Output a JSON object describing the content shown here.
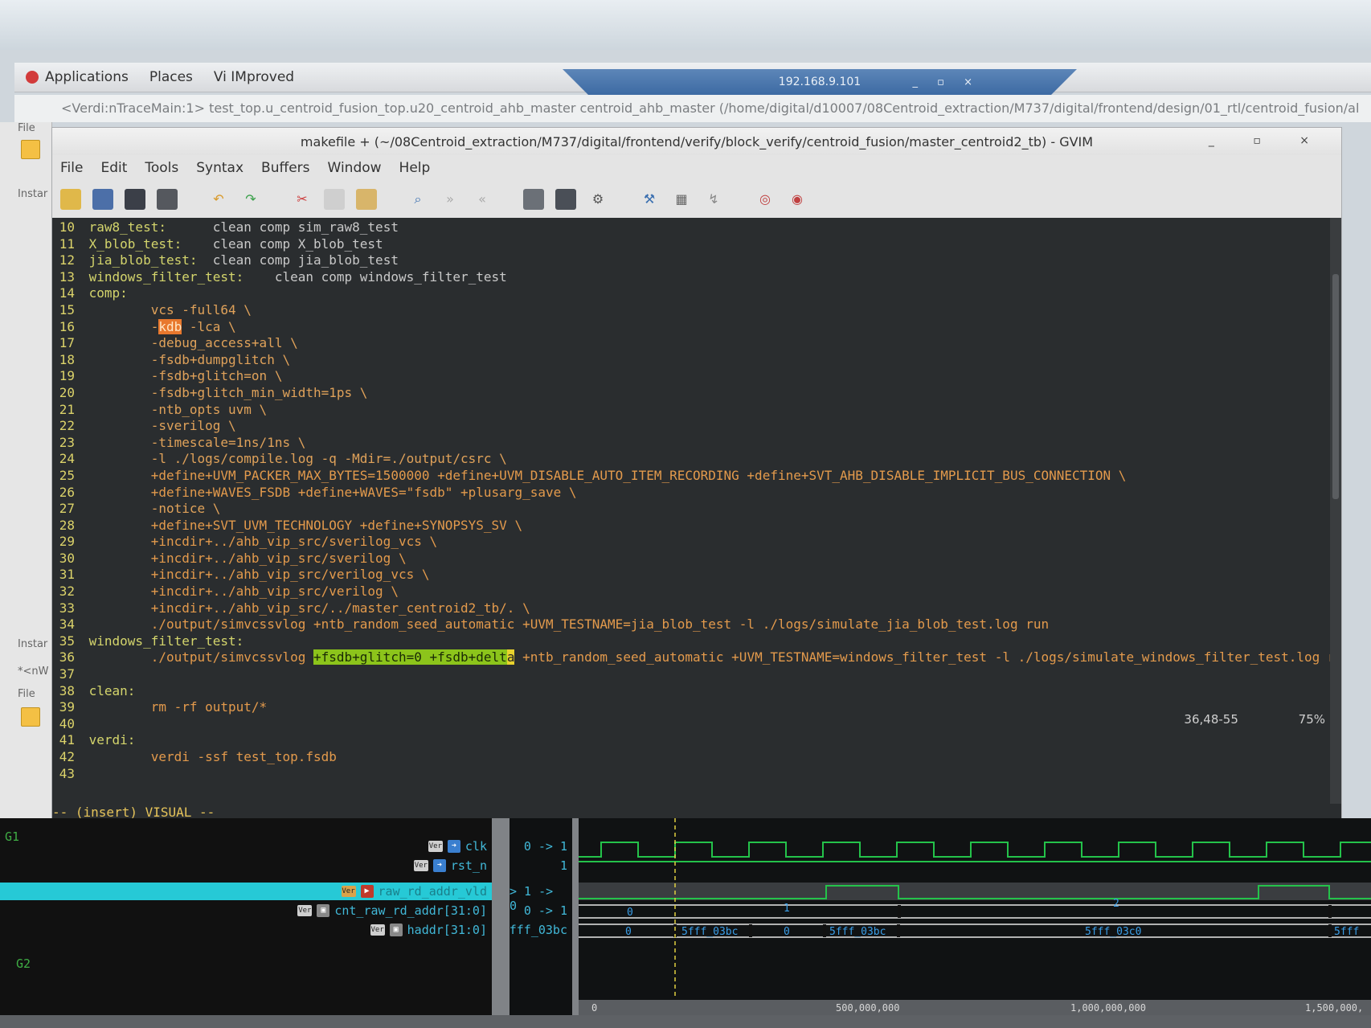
{
  "desktop": {
    "menus": [
      "Applications",
      "Places",
      "Vi IMproved"
    ],
    "remote_title": "192.168.9.101",
    "remote_controls": "_ ▫ ×"
  },
  "verdi": {
    "title": "<Verdi:nTraceMain:1> test_top.u_centroid_fusion_top.u20_centroid_ahb_master centroid_ahb_master (/home/digital/d10007/08Centroid_extraction/M737/digital/frontend/design/01_rtl/centroid_fusion/al",
    "left_labels": [
      "File",
      "Instar",
      "Instar",
      "*<nW",
      "File"
    ]
  },
  "gvim": {
    "title": "makefile + (~/08Centroid_extraction/M737/digital/frontend/verify/block_verify/centroid_fusion/master_centroid2_tb) - GVIM",
    "window_controls": "_ ▫ ×",
    "menu": [
      "File",
      "Edit",
      "Tools",
      "Syntax",
      "Buffers",
      "Window",
      "Help"
    ],
    "toolbar_icons": [
      "open-icon",
      "save-icon",
      "save-all-icon",
      "print-icon",
      "undo-icon",
      "redo-icon",
      "cut-icon",
      "copy-icon",
      "paste-icon",
      "find-replace-icon",
      "find-next-icon",
      "find-prev-icon",
      "load-session-icon",
      "save-session-icon",
      "run-script-icon",
      "make-icon",
      "shell-icon",
      "tags-icon",
      "help-icon",
      "find-help-icon"
    ],
    "lines": [
      {
        "n": "10",
        "parts": [
          {
            "t": " raw8_test:",
            "c": "tgt"
          },
          {
            "t": "      clean comp sim_raw8_test",
            "c": "cmd"
          }
        ]
      },
      {
        "n": "11",
        "parts": [
          {
            "t": " X_blob_test:",
            "c": "tgt"
          },
          {
            "t": "    clean comp X_blob_test",
            "c": "cmd"
          }
        ]
      },
      {
        "n": "12",
        "parts": [
          {
            "t": " jia_blob_test:",
            "c": "tgt"
          },
          {
            "t": "  clean comp jia_blob_test",
            "c": "cmd"
          }
        ]
      },
      {
        "n": "13",
        "parts": [
          {
            "t": " windows_filter_test:",
            "c": "tgt"
          },
          {
            "t": "    clean comp windows_filter_test",
            "c": "cmd"
          }
        ]
      },
      {
        "n": "14",
        "parts": [
          {
            "t": " comp:",
            "c": "tgt"
          }
        ]
      },
      {
        "n": "15",
        "parts": [
          {
            "t": "         vcs -full64 \\",
            "c": "opt"
          }
        ]
      },
      {
        "n": "16",
        "parts": [
          {
            "t": "         -",
            "c": "opt"
          },
          {
            "t": "kdb",
            "c": "hl-orange"
          },
          {
            "t": " -lca \\",
            "c": "opt"
          }
        ]
      },
      {
        "n": "17",
        "parts": [
          {
            "t": "         -debug_access+all \\",
            "c": "opt"
          }
        ]
      },
      {
        "n": "18",
        "parts": [
          {
            "t": "         -fsdb+dumpglitch \\",
            "c": "opt"
          }
        ]
      },
      {
        "n": "19",
        "parts": [
          {
            "t": "         -fsdb+glitch=on \\",
            "c": "opt"
          }
        ]
      },
      {
        "n": "20",
        "parts": [
          {
            "t": "         -fsdb+glitch_min_width=1ps \\",
            "c": "opt"
          }
        ]
      },
      {
        "n": "21",
        "parts": [
          {
            "t": "         -ntb_opts uvm \\",
            "c": "opt"
          }
        ]
      },
      {
        "n": "22",
        "parts": [
          {
            "t": "         -sverilog \\",
            "c": "opt"
          }
        ]
      },
      {
        "n": "23",
        "parts": [
          {
            "t": "         -timescale=1ns/1ns \\",
            "c": "opt"
          }
        ]
      },
      {
        "n": "24",
        "parts": [
          {
            "t": "         -l ./logs/compile.log -q -Mdir=./output/csrc \\",
            "c": "opt"
          }
        ]
      },
      {
        "n": "25",
        "parts": [
          {
            "t": "         +define+UVM_PACKER_MAX_BYTES=1500000 +define+UVM_DISABLE_AUTO_ITEM_RECORDING +define+SVT_AHB_DISABLE_IMPLICIT_BUS_CONNECTION \\",
            "c": "def"
          }
        ]
      },
      {
        "n": "26",
        "parts": [
          {
            "t": "         +define+WAVES_FSDB +define+WAVES=\"fsdb\" +plusarg_save \\",
            "c": "def"
          }
        ]
      },
      {
        "n": "27",
        "parts": [
          {
            "t": "         -notice \\",
            "c": "opt"
          }
        ]
      },
      {
        "n": "28",
        "parts": [
          {
            "t": "         +define+SVT_UVM_TECHNOLOGY +define+SYNOPSYS_SV \\",
            "c": "def"
          }
        ]
      },
      {
        "n": "29",
        "parts": [
          {
            "t": "         +incdir+../ahb_vip_src/sverilog_vcs \\",
            "c": "def"
          }
        ]
      },
      {
        "n": "30",
        "parts": [
          {
            "t": "         +incdir+../ahb_vip_src/sverilog \\",
            "c": "def"
          }
        ]
      },
      {
        "n": "31",
        "parts": [
          {
            "t": "         +incdir+../ahb_vip_src/verilog_vcs \\",
            "c": "def"
          }
        ]
      },
      {
        "n": "32",
        "parts": [
          {
            "t": "         +incdir+../ahb_vip_src/verilog \\",
            "c": "def"
          }
        ]
      },
      {
        "n": "33",
        "parts": [
          {
            "t": "         +incdir+../ahb_vip_src/../master_centroid2_tb/. \\",
            "c": "def"
          }
        ]
      },
      {
        "n": "34",
        "parts": [
          {
            "t": "         ./output/simvcssvlog +ntb_random_seed_automatic +UVM_TESTNAME=jia_blob_test -l ./logs/simulate_jia_blob_test.log run",
            "c": "def"
          }
        ]
      },
      {
        "n": "35",
        "parts": [
          {
            "t": " windows_filter_test:",
            "c": "tgt"
          }
        ]
      },
      {
        "n": "36",
        "parts": [
          {
            "t": "         ./output/simvcssvlog ",
            "c": "def"
          },
          {
            "t": "+fsdb+glitch=0 +fsdb+delt",
            "c": "hl-green"
          },
          {
            "t": "a",
            "c": "hl-cursor"
          },
          {
            "t": " +ntb_random_seed_automatic +UVM_TESTNAME=windows_filter_test -l ./logs/simulate_windows_filter_test.log run",
            "c": "def"
          }
        ]
      },
      {
        "n": "37",
        "parts": []
      },
      {
        "n": "38",
        "parts": [
          {
            "t": " clean:",
            "c": "tgt"
          }
        ]
      },
      {
        "n": "39",
        "parts": [
          {
            "t": "         rm -rf output/*",
            "c": "def"
          }
        ]
      },
      {
        "n": "40",
        "parts": []
      },
      {
        "n": "41",
        "parts": [
          {
            "t": " verdi:",
            "c": "tgt"
          }
        ]
      },
      {
        "n": "42",
        "parts": [
          {
            "t": "         verdi -ssf test_top.fsdb",
            "c": "def"
          }
        ]
      },
      {
        "n": "43",
        "parts": []
      }
    ],
    "ruler_pos": "36,48-55",
    "ruler_pct": "75%",
    "mode": "-- (insert) VISUAL --"
  },
  "wave": {
    "groups": [
      "G1",
      "G2"
    ],
    "signals": [
      {
        "name": "clk",
        "value": "0 -> 1"
      },
      {
        "name": "rst_n",
        "value": "1"
      },
      {
        "name": "raw_rd_addr_vld",
        "value": "> 1 -> 0"
      },
      {
        "name": "cnt_raw_rd_addr[31:0]",
        "value": "0 -> 1"
      },
      {
        "name": "haddr[31:0]",
        "value": "fff_03bc"
      }
    ],
    "wave_labels": {
      "cnt": [
        "0",
        "1",
        "2"
      ],
      "haddr": [
        "0",
        "5fff_03bc",
        "0",
        "5fff_03bc",
        "5fff_03c0",
        "5fff"
      ],
      "right": "5fff"
    },
    "timeline": [
      "0",
      "500,000,000",
      "1,000,000,000",
      "1,500,000,"
    ]
  }
}
